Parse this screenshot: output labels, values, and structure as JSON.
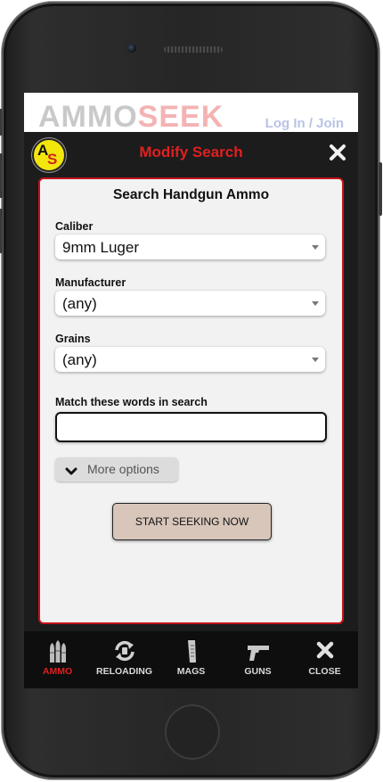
{
  "site": {
    "logo_left": "AMMO",
    "logo_right": "SEEK",
    "login_link": "Log In / Join"
  },
  "modal": {
    "badge_a": "A",
    "badge_s": "S",
    "title": "Modify Search",
    "close_icon": "close-icon"
  },
  "form": {
    "heading": "Search Handgun Ammo",
    "caliber_label": "Caliber",
    "caliber_value": "9mm Luger",
    "manufacturer_label": "Manufacturer",
    "manufacturer_value": "(any)",
    "grains_label": "Grains",
    "grains_value": "(any)",
    "keywords_label": "Match these words in search",
    "keywords_value": "",
    "more_options_label": "More options",
    "start_button_label": "START SEEKING NOW"
  },
  "nav": {
    "items": [
      {
        "label": "AMMO",
        "icon": "ammo-icon",
        "active": true
      },
      {
        "label": "RELOADING",
        "icon": "reloading-icon",
        "active": false
      },
      {
        "label": "MAGS",
        "icon": "magazine-icon",
        "active": false
      },
      {
        "label": "GUNS",
        "icon": "pistol-icon",
        "active": false
      },
      {
        "label": "CLOSE",
        "icon": "close-icon",
        "active": false
      }
    ]
  },
  "colors": {
    "accent_red": "#e21f1f",
    "card_border": "#c5141a",
    "modal_bg": "#1c1c1c",
    "nav_bg": "#0e0e0e",
    "start_button_bg": "#d8c6bb"
  }
}
